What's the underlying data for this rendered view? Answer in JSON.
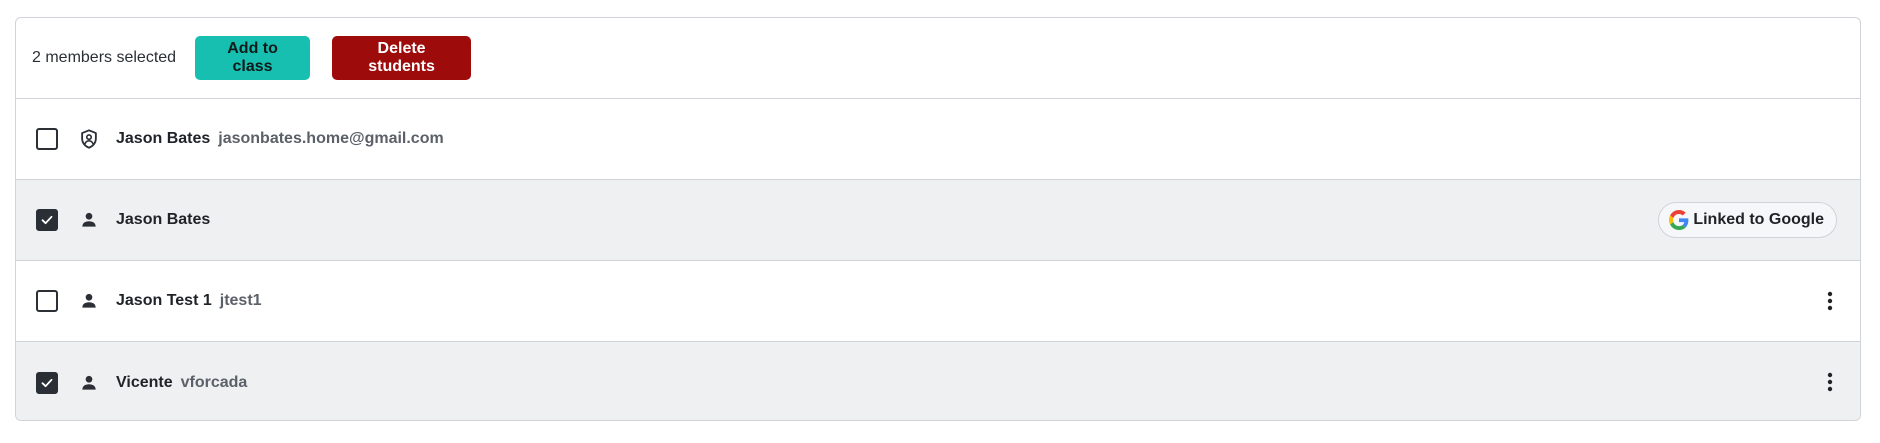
{
  "toolbar": {
    "selected_label": "2 members selected",
    "add_label": "Add to class",
    "delete_label": "Delete students"
  },
  "colors": {
    "add_button": "#17bfb0",
    "delete_button": "#9e0b0b",
    "selected_row": "#eff0f2",
    "checkbox_checked": "#2a2e35"
  },
  "members": [
    {
      "name": "Jason Bates",
      "sub": "jasonbates.home@gmail.com",
      "checked": false,
      "icon": "shield-person-icon"
    },
    {
      "name": "Jason Bates",
      "sub": "",
      "checked": true,
      "icon": "person-icon",
      "badge": "Linked to Google"
    },
    {
      "name": "Jason Test 1",
      "sub": "jtest1",
      "checked": false,
      "icon": "person-icon",
      "menu": "more-vertical-icon"
    },
    {
      "name": "Vicente",
      "sub": "vforcada",
      "checked": true,
      "icon": "person-icon",
      "menu": "more-vertical-icon"
    }
  ]
}
